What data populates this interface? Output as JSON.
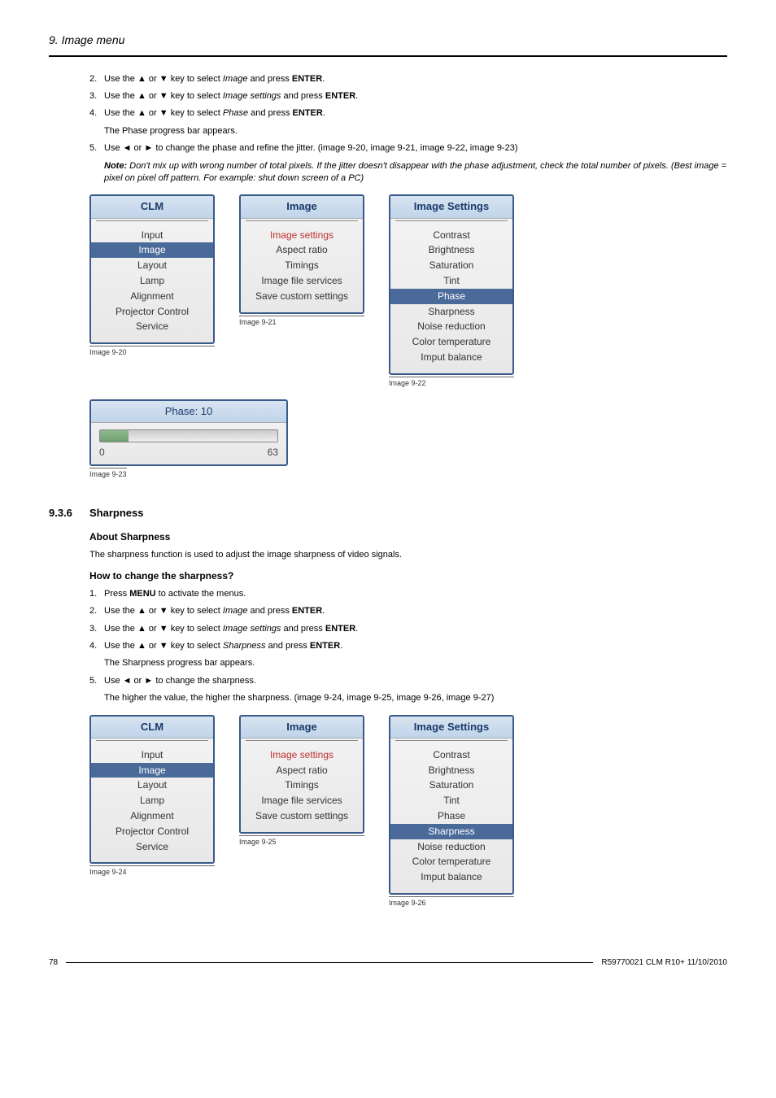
{
  "header": {
    "section": "9. Image menu"
  },
  "top_steps": {
    "s2_num": "2.",
    "s2a": "Use the ▲ or ▼ key to select ",
    "s2_it": "Image",
    "s2b": " and press ",
    "s2_enter": "ENTER",
    "s2c": ".",
    "s3_num": "3.",
    "s3a": "Use the ▲ or ▼ key to select ",
    "s3_it": "Image settings",
    "s3b": " and press ",
    "s3_enter": "ENTER",
    "s3c": ".",
    "s4_num": "4.",
    "s4a": "Use the ▲ or ▼ key to select ",
    "s4_it": "Phase",
    "s4b": " and press ",
    "s4_enter": "ENTER",
    "s4c": ".",
    "s4_sub": "The Phase progress bar appears.",
    "s5_num": "5.",
    "s5a": "Use ◄ or ► to change the phase and refine the jitter. (image 9-20, image 9-21, image 9-22, image 9-23)",
    "note_label": "Note:",
    "note_text": "Don't mix up with wrong number of total pixels. If the jitter doesn't disappear with the phase adjustment, check the total number of pixels. (Best image = pixel on pixel off pattern. For example: shut down screen of a PC)"
  },
  "menu1": {
    "clm_title": "CLM",
    "clm_items": [
      "Input",
      "Image",
      "Layout",
      "Lamp",
      "Alignment",
      "Projector Control",
      "Service"
    ],
    "clm_selected_index": 1,
    "caption": "Image 9-20",
    "img_title": "Image",
    "img_items": [
      "Image settings",
      "Aspect ratio",
      "Timings",
      "Image file services",
      "Save custom settings"
    ],
    "img_highlight_index": 0,
    "img_caption": "Image 9-21",
    "iset_title": "Image Settings",
    "iset_items": [
      "Contrast",
      "Brightness",
      "Saturation",
      "Tint",
      "Phase",
      "Sharpness",
      "Noise reduction",
      "Color temperature",
      "Imput balance"
    ],
    "iset_selected_index": 4,
    "iset_caption": "Image 9-22"
  },
  "progress": {
    "title": "Phase: 10",
    "min": "0",
    "max": "63",
    "caption": "Image 9-23"
  },
  "section936": {
    "num": "9.3.6",
    "title": "Sharpness",
    "about_heading": "About Sharpness",
    "about_text": "The sharpness function is used to adjust the image sharpness of video signals.",
    "how_heading": "How to change the sharpness?",
    "s1_num": "1.",
    "s1a": "Press ",
    "s1_menu": "MENU",
    "s1b": " to activate the menus.",
    "s2_num": "2.",
    "s2a": "Use the ▲ or ▼ key to select ",
    "s2_it": "Image",
    "s2b": " and press ",
    "s2_enter": "ENTER",
    "s2c": ".",
    "s3_num": "3.",
    "s3a": "Use the ▲ or ▼ key to select ",
    "s3_it": "Image settings",
    "s3b": " and press ",
    "s3_enter": "ENTER",
    "s3c": ".",
    "s4_num": "4.",
    "s4a": "Use the ▲ or ▼ key to select ",
    "s4_it": "Sharpness",
    "s4b": " and press ",
    "s4_enter": "ENTER",
    "s4c": ".",
    "s4_sub": "The Sharpness progress bar appears.",
    "s5_num": "5.",
    "s5a": "Use ◄ or ► to change the sharpness.",
    "s5_sub": "The higher the value, the higher the sharpness. (image 9-24, image 9-25, image 9-26, image 9-27)"
  },
  "menu2": {
    "clm_title": "CLM",
    "clm_items": [
      "Input",
      "Image",
      "Layout",
      "Lamp",
      "Alignment",
      "Projector Control",
      "Service"
    ],
    "clm_selected_index": 1,
    "caption": "Image 9-24",
    "img_title": "Image",
    "img_items": [
      "Image settings",
      "Aspect ratio",
      "Timings",
      "Image file services",
      "Save custom settings"
    ],
    "img_highlight_index": 0,
    "img_caption": "Image 9-25",
    "iset_title": "Image Settings",
    "iset_items": [
      "Contrast",
      "Brightness",
      "Saturation",
      "Tint",
      "Phase",
      "Sharpness",
      "Noise reduction",
      "Color temperature",
      "Imput balance"
    ],
    "iset_selected_index": 5,
    "iset_caption": "Image 9-26"
  },
  "footer": {
    "page": "78",
    "doc": "R59770021  CLM R10+  11/10/2010"
  }
}
